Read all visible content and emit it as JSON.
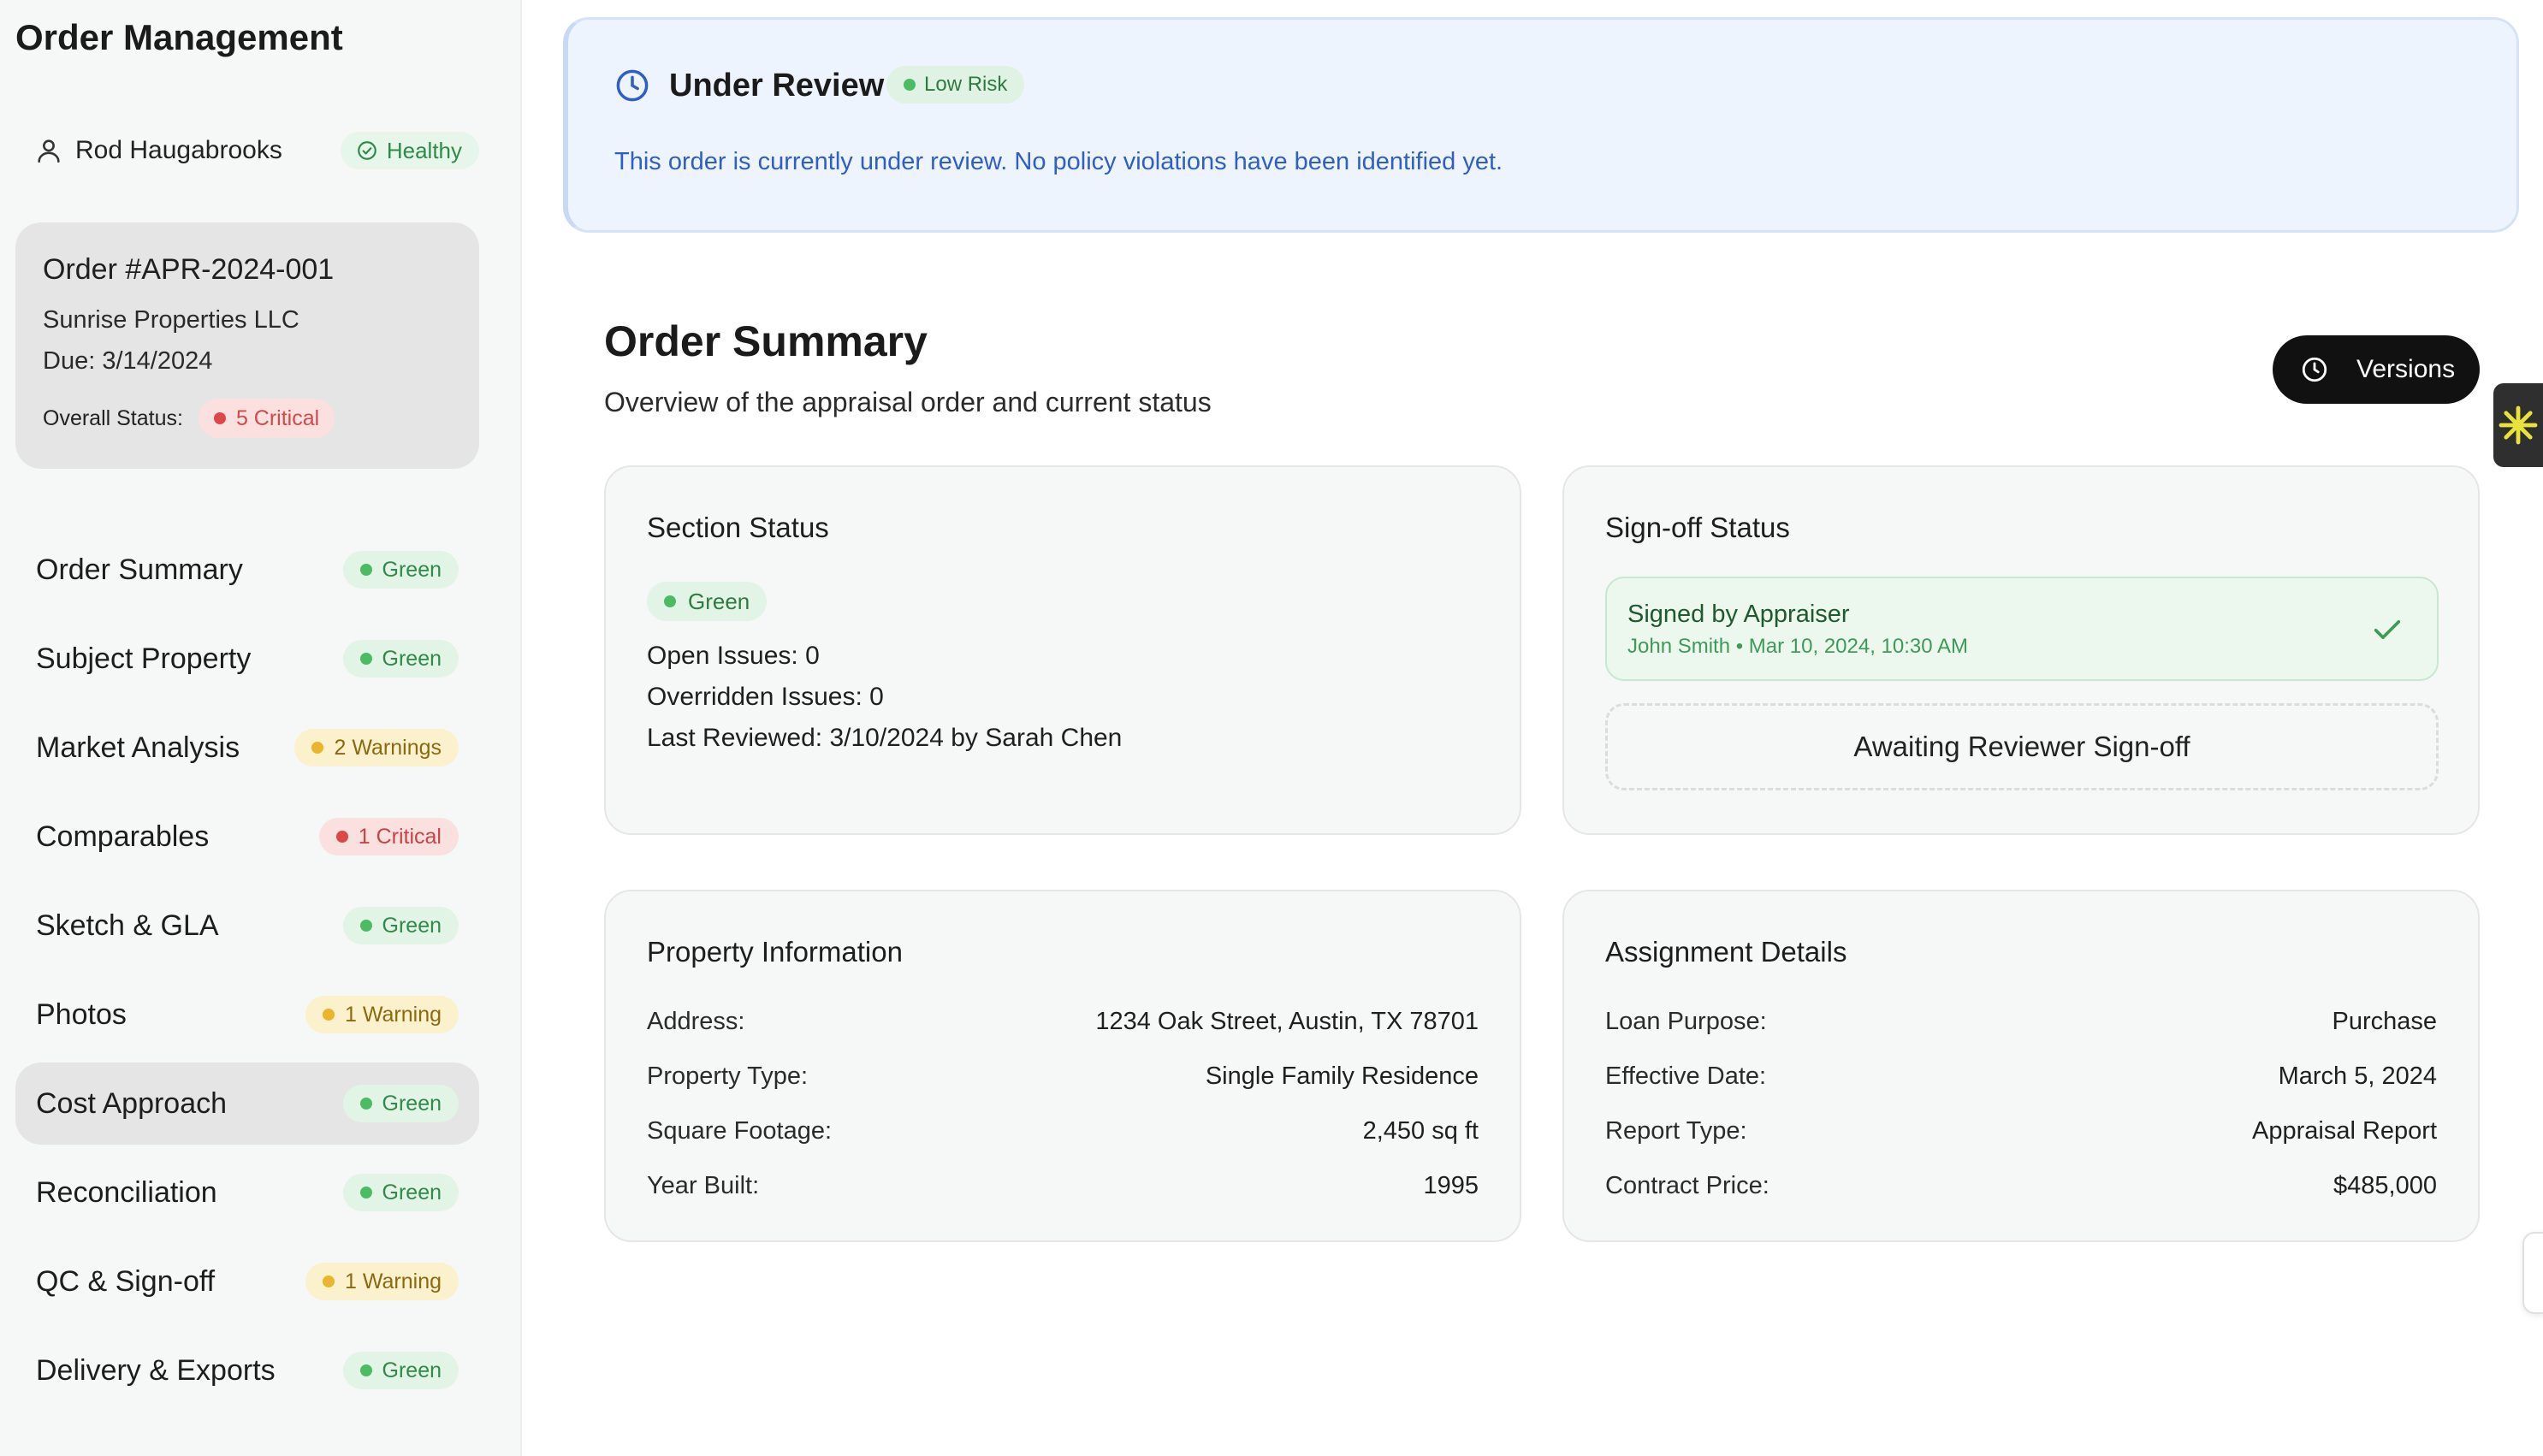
{
  "sidebar": {
    "app_title": "Order Management",
    "user": {
      "name": "Rod Haugabrooks",
      "health": "Healthy",
      "icon": "user-icon"
    },
    "order": {
      "id": "Order #APR-2024-001",
      "client": "Sunrise Properties LLC",
      "due": "Due: 3/14/2024",
      "overall_label": "Overall Status:",
      "overall_badge": "5 Critical"
    },
    "nav": [
      {
        "label": "Order Summary",
        "badge": "Green",
        "status": "green"
      },
      {
        "label": "Subject Property",
        "badge": "Green",
        "status": "green"
      },
      {
        "label": "Market Analysis",
        "badge": "2 Warnings",
        "status": "yellow"
      },
      {
        "label": "Comparables",
        "badge": "1 Critical",
        "status": "red"
      },
      {
        "label": "Sketch & GLA",
        "badge": "Green",
        "status": "green"
      },
      {
        "label": "Photos",
        "badge": "1 Warning",
        "status": "yellow"
      },
      {
        "label": "Cost Approach",
        "badge": "Green",
        "status": "green",
        "active": true
      },
      {
        "label": "Reconciliation",
        "badge": "Green",
        "status": "green"
      },
      {
        "label": "QC & Sign-off",
        "badge": "1 Warning",
        "status": "yellow"
      },
      {
        "label": "Delivery & Exports",
        "badge": "Green",
        "status": "green"
      }
    ]
  },
  "banner": {
    "title": "Under Review",
    "risk": "Low Risk",
    "message": "This order is currently under review. No policy violations have been identified yet.",
    "icon": "clock-icon"
  },
  "main": {
    "title": "Order Summary",
    "subtitle": "Overview of the appraisal order and current status",
    "versions_label": "Versions",
    "section_status": {
      "title": "Section Status",
      "badge": "Green",
      "open_issues": "Open Issues: 0",
      "overridden_issues": "Overridden Issues: 0",
      "last_reviewed": "Last Reviewed: 3/10/2024 by Sarah Chen"
    },
    "signoff": {
      "title": "Sign-off Status",
      "signed_title": "Signed by Appraiser",
      "signed_sub": "John Smith • Mar 10, 2024, 10:30 AM",
      "awaiting": "Awaiting Reviewer Sign-off"
    },
    "property": {
      "title": "Property Information",
      "rows": [
        {
          "k": "Address:",
          "v": "1234 Oak Street, Austin, TX 78701"
        },
        {
          "k": "Property Type:",
          "v": "Single Family Residence"
        },
        {
          "k": "Square Footage:",
          "v": "2,450 sq ft"
        },
        {
          "k": "Year Built:",
          "v": "1995"
        }
      ]
    },
    "assignment": {
      "title": "Assignment Details",
      "rows": [
        {
          "k": "Loan Purpose:",
          "v": "Purchase"
        },
        {
          "k": "Effective Date:",
          "v": "March 5, 2024"
        },
        {
          "k": "Report Type:",
          "v": "Appraisal Report"
        },
        {
          "k": "Contract Price:",
          "v": "$485,000"
        }
      ]
    }
  },
  "colors": {
    "green": "#4cbb64",
    "yellow": "#e9b52b",
    "red": "#de4747",
    "banner_text": "#2f5fc4",
    "side_tab_star": "#e8e23a"
  }
}
